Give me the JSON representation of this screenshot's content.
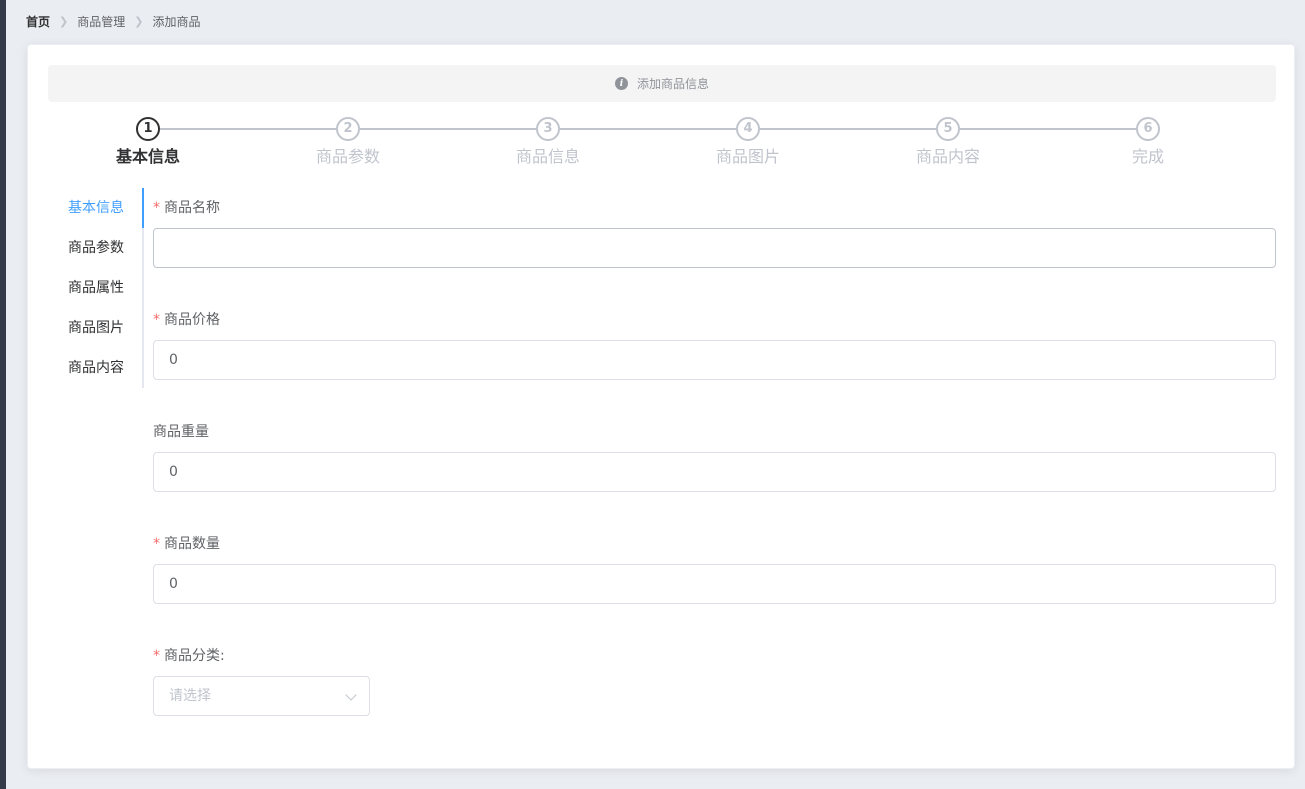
{
  "breadcrumb": {
    "items": [
      "首页",
      "商品管理",
      "添加商品"
    ]
  },
  "alert": {
    "icon": "info-icon",
    "text": "添加商品信息"
  },
  "steps": {
    "active_index": 0,
    "items": [
      {
        "number": "1",
        "title": "基本信息"
      },
      {
        "number": "2",
        "title": "商品参数"
      },
      {
        "number": "3",
        "title": "商品信息"
      },
      {
        "number": "4",
        "title": "商品图片"
      },
      {
        "number": "5",
        "title": "商品内容"
      },
      {
        "number": "6",
        "title": "完成"
      }
    ]
  },
  "tabs": {
    "active_index": 0,
    "items": [
      "基本信息",
      "商品参数",
      "商品属性",
      "商品图片",
      "商品内容"
    ]
  },
  "form": {
    "goods_name": {
      "label": "商品名称",
      "required": "*",
      "value": ""
    },
    "goods_price": {
      "label": "商品价格",
      "required": "*",
      "value": "0"
    },
    "goods_weight": {
      "label": "商品重量",
      "value": "0"
    },
    "goods_number": {
      "label": "商品数量",
      "required": "*",
      "value": "0"
    },
    "goods_cat": {
      "label": "商品分类:",
      "required": "*",
      "placeholder": "请选择"
    }
  },
  "colors": {
    "accent": "#409eff",
    "required": "#f56c6c",
    "inactive_step": "#c0c4cc"
  }
}
